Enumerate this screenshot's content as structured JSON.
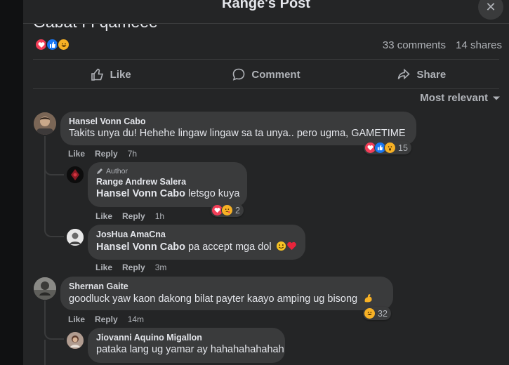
{
  "header": {
    "title": "Range's Post",
    "close_icon": "close-icon"
  },
  "post": {
    "text_partial": "Gabat I I qameee",
    "reactions": [
      "love",
      "like",
      "haha"
    ],
    "comments_count": "33 comments",
    "shares_count": "14 shares"
  },
  "actions": {
    "like": "Like",
    "comment": "Comment",
    "share": "Share"
  },
  "sort": {
    "label": "Most relevant"
  },
  "comments": [
    {
      "name": "Hansel Vonn Cabo",
      "text": "Takits unya du! Hehehe lingaw lingaw sa ta unya.. pero ugma, GAMETIME",
      "like": "Like",
      "reply": "Reply",
      "time": "7h",
      "reaction_count": "15",
      "replies": [
        {
          "author_label": "Author",
          "name": "Range Andrew Salera",
          "mention": "Hansel Vonn Cabo",
          "text": " letsgo kuya",
          "like": "Like",
          "reply": "Reply",
          "time": "1h",
          "reaction_count": "2"
        },
        {
          "name": "JosHua AmaCna",
          "mention": "Hansel Vonn Cabo",
          "text": " pa accept mga dol",
          "like": "Like",
          "reply": "Reply",
          "time": "3m"
        }
      ]
    },
    {
      "name": "Shernan Gaite",
      "text": "goodluck yaw kaon dakong bilat payter kaayo amping ug bisong",
      "like": "Like",
      "reply": "Reply",
      "time": "14m",
      "reaction_count": "32",
      "replies": [
        {
          "name": "Jiovanni Aquino Migallon",
          "text": "pataka lang ug yamar ay hahahahahahah"
        }
      ]
    }
  ],
  "colors": {
    "background": "#242526",
    "bubble": "#3a3b3c",
    "text": "#e4e6eb",
    "muted": "#b0b3b8",
    "love": "#f33e58",
    "like": "#1877f2",
    "haha": "#f7b125"
  }
}
